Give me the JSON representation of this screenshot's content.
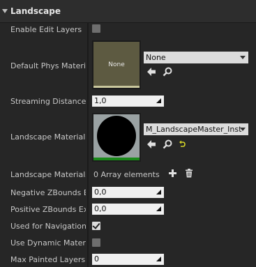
{
  "section": {
    "title": "Landscape"
  },
  "rows": {
    "enable_edit_layers": {
      "label": "Enable Edit Layers",
      "checked": false
    },
    "default_phys_material": {
      "label": "Default Phys Material",
      "thumb_text": "None",
      "selected": "None"
    },
    "streaming_distance": {
      "label": "Streaming Distance M",
      "value": "1,0"
    },
    "landscape_material": {
      "label": "Landscape Material",
      "selected": "M_LandscapeMaster_Inst"
    },
    "landscape_materials_override": {
      "label": "Landscape Materials O",
      "value": "0 Array elements"
    },
    "negative_zbounds": {
      "label": "Negative ZBounds Ext",
      "value": "0,0"
    },
    "positive_zbounds": {
      "label": "Positive ZBounds Exte",
      "value": "0,0"
    },
    "used_for_navigation": {
      "label": "Used for Navigation",
      "checked": true
    },
    "use_dynamic_material": {
      "label": "Use Dynamic Material",
      "checked": false
    },
    "max_painted_layers": {
      "label": "Max Painted Layers P",
      "value": "0"
    }
  },
  "icons": {
    "collapse": "triangle-down-icon",
    "use_selected": "arrow-left-icon",
    "browse": "search-icon",
    "reset": "reset-arrow-icon",
    "add": "plus-icon",
    "delete": "trash-icon"
  },
  "colors": {
    "background": "#262626",
    "header": "#2d2d2d",
    "reset_accent": "#d6d628",
    "material_bar": "#1a8a1a"
  }
}
